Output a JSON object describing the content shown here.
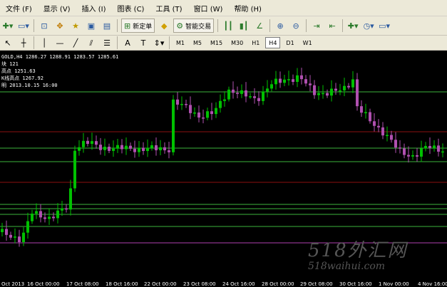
{
  "menu": [
    "文件 (F)",
    "显示 (V)",
    "插入 (I)",
    "图表 (C)",
    "工具 (T)",
    "窗口 (W)",
    "帮助 (H)"
  ],
  "toolbar": {
    "new_order_label": "新定单",
    "expert_label": "智能交易"
  },
  "timeframes": [
    "M1",
    "M5",
    "M15",
    "M30",
    "H1",
    "H4",
    "D1",
    "W1"
  ],
  "active_timeframe": "H4",
  "info": {
    "symbol_line": "GOLD,H4  1286.27 1288.91 1283.57 1285.61",
    "line2": "块  121",
    "line3": "高点 1251.63",
    "line4": "K线高点 1267.92",
    "line5": "明 2013.10.15 16:00"
  },
  "x_labels": [
    "Oct 2013",
    "16 Oct 00:00",
    "17 Oct 08:00",
    "18 Oct 16:00",
    "22 Oct 00:00",
    "23 Oct 08:00",
    "24 Oct 16:00",
    "28 Oct 00:00",
    "29 Oct 08:00",
    "30 Oct 16:00",
    "1 Nov 00:00",
    "4 Nov 16:00"
  ],
  "watermark": {
    "line1": "518外汇网",
    "line2": "518waihui.com"
  },
  "colors": {
    "bull": "#00c000",
    "bear": "#b050b0",
    "green_line": "#3cb43c",
    "red_line": "#8b1010",
    "magenta_line": "#b040b0"
  }
}
